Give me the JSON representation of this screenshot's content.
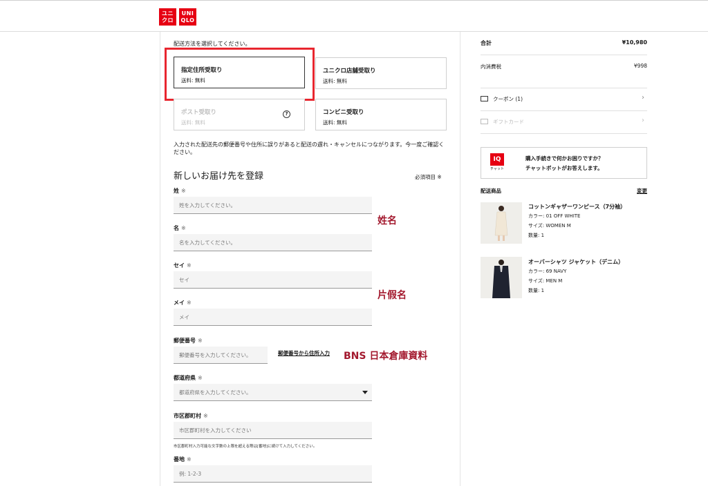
{
  "header": {
    "logo_top": "ユニ\nクロ",
    "logo_bottom": "UNI\nQLO",
    "logo_color": "#e60012"
  },
  "delivery": {
    "instruction": "配送方法を選択してください。",
    "options": [
      {
        "title": "指定住所受取り",
        "sub": "送料: 無料"
      },
      {
        "title": "ユニクロ店舗受取り",
        "sub": "送料: 無料"
      },
      {
        "title": "ポスト受取り",
        "sub": "送料: 無料"
      },
      {
        "title": "コンビニ受取り",
        "sub": "送料: 無料"
      }
    ],
    "notice": "入力された配送先の郵便番号や住所に誤りがあると配送の遅れ・キャンセルにつながります。今一度ご確認ください。"
  },
  "form": {
    "title": "新しいお届け先を登録",
    "required_note": "必須項目 ※",
    "req_mark": "※",
    "fields": {
      "last_name": {
        "label": "姓",
        "placeholder": "姓を入力してください。"
      },
      "first_name": {
        "label": "名",
        "placeholder": "名を入力してください。"
      },
      "kana_last": {
        "label": "セイ",
        "placeholder": "セイ"
      },
      "kana_first": {
        "label": "メイ",
        "placeholder": "メイ"
      },
      "postal": {
        "label": "郵便番号",
        "placeholder": "郵便番号を入力してください。",
        "link": "郵便番号から住所入力"
      },
      "prefecture": {
        "label": "都道府県",
        "placeholder": "都道府県を入力してください。"
      },
      "city": {
        "label": "市区郡町村",
        "placeholder": "市区郡町村を入力してください",
        "hint": "市区郡町村入力可能な文字数の上限を超える際は[番地]に続けて入力してください。"
      },
      "street": {
        "label": "番地",
        "placeholder": "例: 1-2-3"
      }
    }
  },
  "annotations": {
    "name": "姓名",
    "kana": "片假名",
    "warehouse": "BNS 日本倉庫資料",
    "color": "#a3192e"
  },
  "summary": {
    "total_label": "合計",
    "total_value": "¥10,980",
    "tax_label": "内消費税",
    "tax_value": "¥998",
    "coupon": "クーポン (1)",
    "giftcard": "ギフトカード",
    "help_title": "購入手続きで何かお困りですか？",
    "help_sub": "チャットボットがお答えします。",
    "iq_logo": "IQ",
    "iq_caption": "チャット",
    "items_label": "配送商品",
    "items_change": "変更",
    "items": [
      {
        "name": "コットンギャザーワンピース（7分袖）",
        "color": "カラー: 01 OFF WHITE",
        "size": "サイズ: WOMEN M",
        "qty": "数量: 1"
      },
      {
        "name": "オーバーシャツ ジャケット（デニム）",
        "color": "カラー: 69 NAVY",
        "size": "サイズ: MEN M",
        "qty": "数量: 1"
      }
    ]
  }
}
